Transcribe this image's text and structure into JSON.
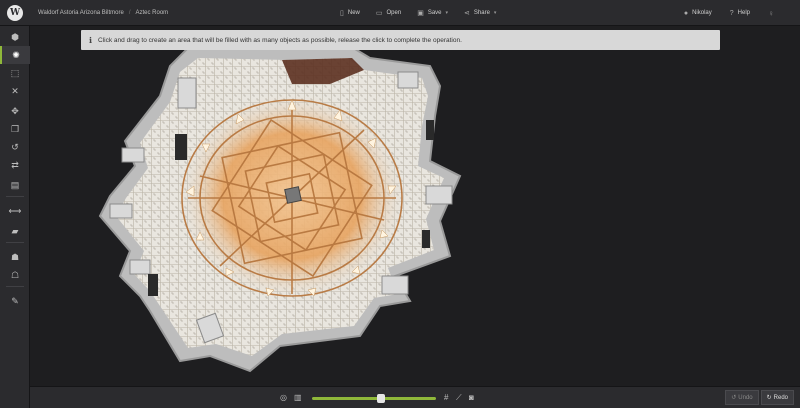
{
  "app": {
    "logo_letter": "W"
  },
  "breadcrumb": {
    "project": "Waldorf Astoria Arizona Biltmore",
    "separator": "/",
    "room": "Aztec Room"
  },
  "menu": {
    "new_label": "New",
    "open_label": "Open",
    "save_label": "Save",
    "share_label": "Share",
    "caret": "▾"
  },
  "user": {
    "name": "Nikolay",
    "help_label": "Help"
  },
  "banner": {
    "icon": "info-icon",
    "text": "Click and drag to create an area that will be filled with as many objects as possible, release the click to complete the operation."
  },
  "sidebar": {
    "active_index": 1,
    "items": [
      {
        "name": "cube-icon",
        "glyph": "⬢"
      },
      {
        "name": "fill-area-icon",
        "glyph": "✺"
      },
      {
        "name": "select-area-icon",
        "glyph": "⬚"
      },
      {
        "name": "close-icon",
        "glyph": "✕"
      },
      {
        "name": "move-icon",
        "glyph": "✥"
      },
      {
        "name": "copy-icon",
        "glyph": "❐"
      },
      {
        "name": "rotate-icon",
        "glyph": "↺"
      },
      {
        "name": "swap-icon",
        "glyph": "⇄"
      },
      {
        "name": "trash-icon",
        "glyph": "▤"
      },
      {
        "name": "measure-icon",
        "glyph": "⟷"
      },
      {
        "name": "ruler-icon",
        "glyph": "▰"
      },
      {
        "name": "people-icon",
        "glyph": "☗"
      },
      {
        "name": "seating-icon",
        "glyph": "☖"
      },
      {
        "name": "edit-icon",
        "glyph": "✎"
      }
    ]
  },
  "bottom": {
    "zoom_value": 0.56,
    "undo_label": "Undo",
    "redo_label": "Redo"
  },
  "colors": {
    "accent": "#8fb83a",
    "panel": "#2b2b2e",
    "background": "#1e1e20",
    "wall": "#cfcfcf",
    "floor": "#e3b27a"
  }
}
